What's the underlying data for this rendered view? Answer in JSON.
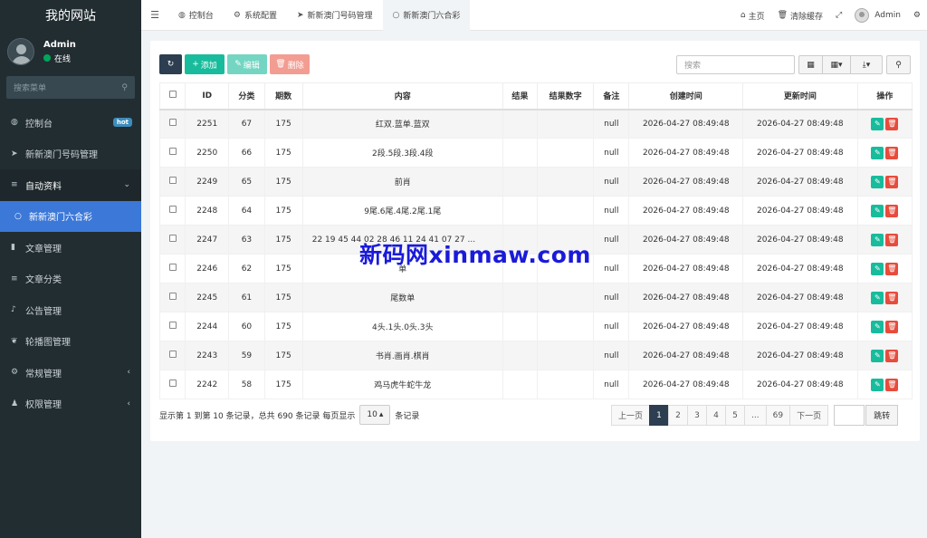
{
  "sidebar": {
    "brand": "我的网站",
    "user": {
      "name": "Admin",
      "status": "在线"
    },
    "search_placeholder": "搜索菜单",
    "items": [
      {
        "icon": "dashboard-icon",
        "glyph": "◍",
        "label": "控制台",
        "badge": "hot"
      },
      {
        "icon": "send-icon",
        "glyph": "➤",
        "label": "新新澳门号码管理"
      },
      {
        "icon": "list-icon",
        "glyph": "≡",
        "label": "自动资料",
        "arrow": "⌄"
      },
      {
        "icon": "circle-icon",
        "glyph": "○",
        "label": "新新澳门六合彩"
      },
      {
        "icon": "bookmark-icon",
        "glyph": "▮",
        "label": "文章管理"
      },
      {
        "icon": "list-icon",
        "glyph": "≡",
        "label": "文章分类"
      },
      {
        "icon": "bell-icon",
        "glyph": "♪",
        "label": "公告管理"
      },
      {
        "icon": "leaf-icon",
        "glyph": "❦",
        "label": "轮播图管理"
      },
      {
        "icon": "cogs-icon",
        "glyph": "⚙",
        "label": "常规管理",
        "arrow": "‹"
      },
      {
        "icon": "users-icon",
        "glyph": "♟",
        "label": "权限管理",
        "arrow": "‹"
      }
    ]
  },
  "topbar": {
    "tabs": [
      {
        "icon": "dashboard-icon",
        "glyph": "◍",
        "label": "控制台"
      },
      {
        "icon": "gear-icon",
        "glyph": "⚙",
        "label": "系统配置"
      },
      {
        "icon": "send-icon",
        "glyph": "➤",
        "label": "新新澳门号码管理"
      },
      {
        "icon": "circle-icon",
        "glyph": "○",
        "label": "新新澳门六合彩"
      }
    ],
    "home": "主页",
    "clear_cache": "清除缓存",
    "admin": "Admin"
  },
  "toolbar": {
    "add": "添加",
    "edit": "编辑",
    "delete": "删除",
    "search_placeholder": "搜索"
  },
  "table": {
    "headers": [
      "ID",
      "分类",
      "期数",
      "内容",
      "结果",
      "结果数字",
      "备注",
      "创建时间",
      "更新时间",
      "操作"
    ],
    "rows": [
      {
        "id": "2251",
        "cat": "67",
        "period": "175",
        "content": "红双.蓝单.蓝双",
        "result": "",
        "num": "",
        "note": "null",
        "created": "2026-04-27 08:49:48",
        "updated": "2026-04-27 08:49:48"
      },
      {
        "id": "2250",
        "cat": "66",
        "period": "175",
        "content": "2段.5段.3段.4段",
        "result": "",
        "num": "",
        "note": "null",
        "created": "2026-04-27 08:49:48",
        "updated": "2026-04-27 08:49:48"
      },
      {
        "id": "2249",
        "cat": "65",
        "period": "175",
        "content": "前肖",
        "result": "",
        "num": "",
        "note": "null",
        "created": "2026-04-27 08:49:48",
        "updated": "2026-04-27 08:49:48"
      },
      {
        "id": "2248",
        "cat": "64",
        "period": "175",
        "content": "9尾.6尾.4尾.2尾.1尾",
        "result": "",
        "num": "",
        "note": "null",
        "created": "2026-04-27 08:49:48",
        "updated": "2026-04-27 08:49:48"
      },
      {
        "id": "2247",
        "cat": "63",
        "period": "175",
        "content": "22 19 45 44 02 28 46 11 24 41 07 27 ...",
        "result": "",
        "num": "",
        "note": "null",
        "created": "2026-04-27 08:49:48",
        "updated": "2026-04-27 08:49:48"
      },
      {
        "id": "2246",
        "cat": "62",
        "period": "175",
        "content": "单",
        "result": "",
        "num": "",
        "note": "null",
        "created": "2026-04-27 08:49:48",
        "updated": "2026-04-27 08:49:48"
      },
      {
        "id": "2245",
        "cat": "61",
        "period": "175",
        "content": "尾数单",
        "result": "",
        "num": "",
        "note": "null",
        "created": "2026-04-27 08:49:48",
        "updated": "2026-04-27 08:49:48"
      },
      {
        "id": "2244",
        "cat": "60",
        "period": "175",
        "content": "4头.1头.0头.3头",
        "result": "",
        "num": "",
        "note": "null",
        "created": "2026-04-27 08:49:48",
        "updated": "2026-04-27 08:49:48"
      },
      {
        "id": "2243",
        "cat": "59",
        "period": "175",
        "content": "书肖.画肖.棋肖",
        "result": "",
        "num": "",
        "note": "null",
        "created": "2026-04-27 08:49:48",
        "updated": "2026-04-27 08:49:48"
      },
      {
        "id": "2242",
        "cat": "58",
        "period": "175",
        "content": "鸡马虎牛蛇牛龙",
        "result": "",
        "num": "",
        "note": "null",
        "created": "2026-04-27 08:49:48",
        "updated": "2026-04-27 08:49:48"
      }
    ]
  },
  "footer": {
    "info_prefix": "显示第 1 到第 10 条记录，总共 690 条记录 每页显示",
    "page_size": "10",
    "info_suffix": "条记录",
    "pages": [
      "上一页",
      "1",
      "2",
      "3",
      "4",
      "5",
      "...",
      "69",
      "下一页"
    ],
    "active_page": "1",
    "jump": "跳转"
  },
  "watermark": "新码网xinmaw.com"
}
